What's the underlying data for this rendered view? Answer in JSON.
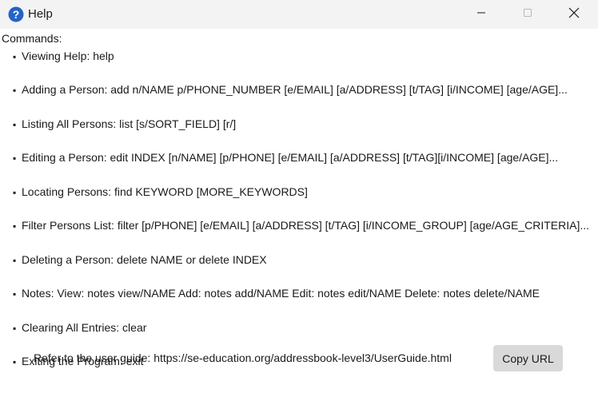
{
  "window": {
    "title": "Help",
    "icon": "help-question-icon",
    "accent": "#2463c7"
  },
  "controls": {
    "minimize_icon": "minimize-icon",
    "maximize_icon": "maximize-icon",
    "close_icon": "close-icon"
  },
  "content": {
    "heading": "Commands:",
    "bullet": "▪",
    "commands": [
      "Viewing Help: help",
      "Adding a Person: add n/NAME p/PHONE_NUMBER [e/EMAIL] [a/ADDRESS] [t/TAG] [i/INCOME] [age/AGE]...",
      "Listing All Persons: list [s/SORT_FIELD] [r/]",
      "Editing a Person: edit INDEX [n/NAME] [p/PHONE] [e/EMAIL] [a/ADDRESS] [t/TAG][i/INCOME] [age/AGE]...",
      "Locating Persons: find KEYWORD [MORE_KEYWORDS]",
      "Filter Persons List: filter [p/PHONE] [e/EMAIL] [a/ADDRESS] [t/TAG] [i/INCOME_GROUP] [age/AGE_CRITERIA]...",
      "Deleting a Person: delete NAME or delete INDEX",
      "Notes: View: notes view/NAME Add: notes add/NAME Edit: notes edit/NAME Delete: notes delete/NAME",
      "Clearing All Entries: clear",
      "Exiting the Program: exit"
    ]
  },
  "footer": {
    "guide_text": "Refer to the user guide: https://se-education.org/addressbook-level3/UserGuide.html",
    "copy_button_label": "Copy URL"
  }
}
